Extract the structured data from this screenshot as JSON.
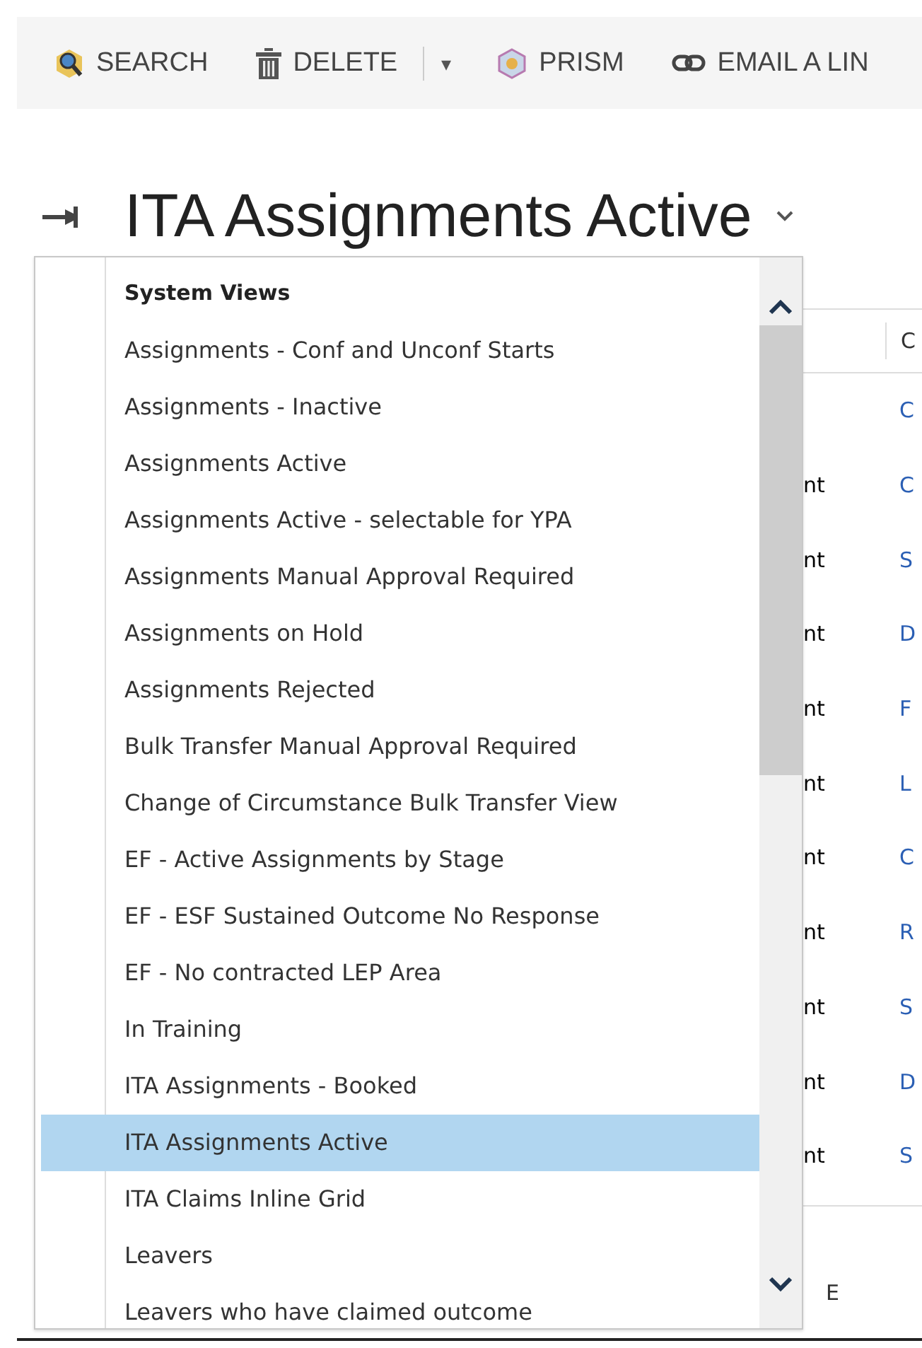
{
  "toolbar": [
    {
      "kind": "search",
      "label": "SEARCH"
    },
    {
      "kind": "delete",
      "label": "DELETE"
    },
    {
      "kind": "split",
      "label": "▾"
    },
    {
      "kind": "prism",
      "label": "PRISM"
    },
    {
      "kind": "link",
      "label": "EMAIL A LIN"
    }
  ],
  "view_title": "ITA Assignments Active",
  "view_menu": {
    "heading": "System Views",
    "items": [
      {
        "label": "Assignments - Conf and Unconf Starts",
        "selected": false
      },
      {
        "label": "Assignments - Inactive",
        "selected": false
      },
      {
        "label": "Assignments Active",
        "selected": false
      },
      {
        "label": "Assignments Active - selectable for YPA",
        "selected": false
      },
      {
        "label": "Assignments Manual Approval Required",
        "selected": false
      },
      {
        "label": "Assignments on Hold",
        "selected": false
      },
      {
        "label": "Assignments Rejected",
        "selected": false
      },
      {
        "label": "Bulk Transfer Manual Approval Required",
        "selected": false
      },
      {
        "label": "Change of Circumstance Bulk Transfer View",
        "selected": false
      },
      {
        "label": "EF - Active Assignments by Stage",
        "selected": false
      },
      {
        "label": "EF - ESF Sustained Outcome No Response",
        "selected": false
      },
      {
        "label": "EF - No contracted LEP Area",
        "selected": false
      },
      {
        "label": "In Training",
        "selected": false
      },
      {
        "label": "ITA Assignments - Booked",
        "selected": false
      },
      {
        "label": "ITA Assignments Active",
        "selected": true
      },
      {
        "label": "ITA Claims Inline Grid",
        "selected": false
      },
      {
        "label": "Leavers",
        "selected": false
      },
      {
        "label": "Leavers who have claimed outcome",
        "selected": false
      }
    ]
  },
  "grid": {
    "header": "C",
    "rows": [
      {
        "column_2": "C"
      },
      {
        "column_1": "nt",
        "column_2": "C"
      },
      {
        "column_1": "nt",
        "column_2": "S"
      },
      {
        "column_1": "nt",
        "column_2": "D"
      },
      {
        "column_1": "nt",
        "column_2": "F"
      },
      {
        "column_1": "nt",
        "column_2": "L"
      },
      {
        "column_1": "nt",
        "column_2": "C"
      },
      {
        "column_1": "nt",
        "column_2": "R"
      },
      {
        "column_1": "nt",
        "column_2": "S"
      },
      {
        "column_1": "nt",
        "column_2": "D"
      },
      {
        "column_1": "nt",
        "column_2": "S"
      }
    ],
    "footer": "E"
  }
}
